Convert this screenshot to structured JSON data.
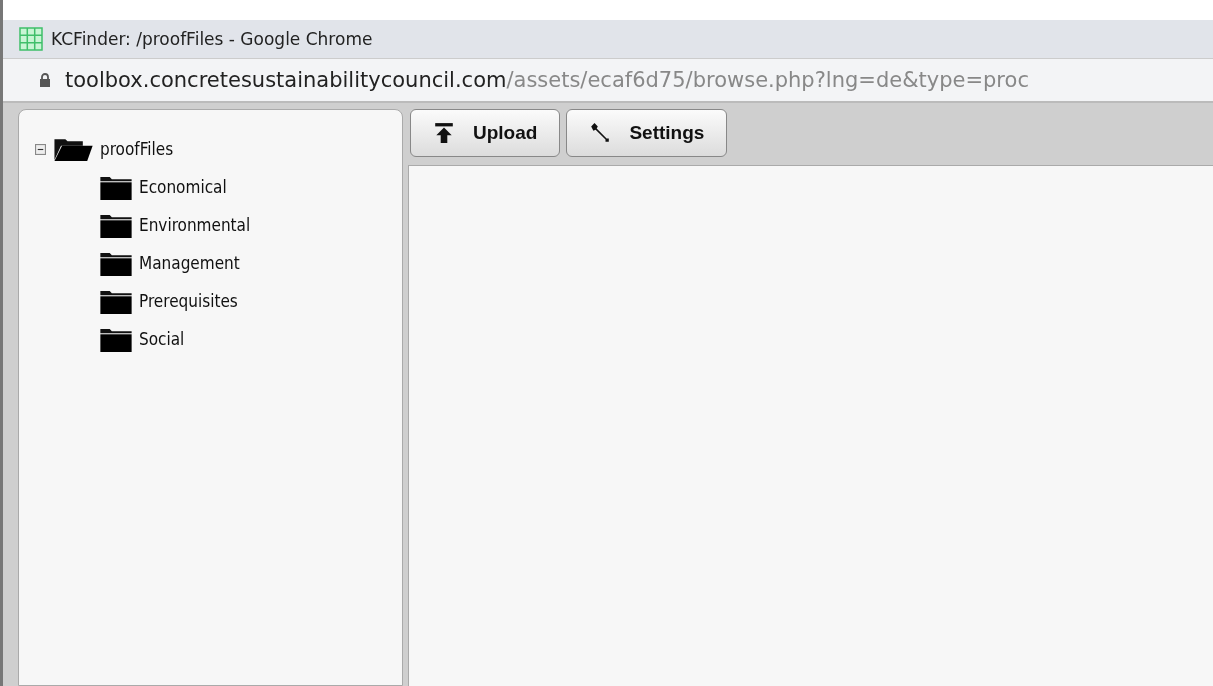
{
  "window": {
    "title": "KCFinder: /proofFiles - Google Chrome"
  },
  "address_bar": {
    "host": "toolbox.concretesustainabilitycouncil.com",
    "path": "/assets/ecaf6d75/browse.php?lng=de&type=proc"
  },
  "tree": [
    {
      "label": "proofFiles",
      "expanded": true,
      "children": [
        {
          "label": "Economical"
        },
        {
          "label": "Environmental"
        },
        {
          "label": "Management"
        },
        {
          "label": "Prerequisites"
        },
        {
          "label": "Social"
        }
      ]
    }
  ],
  "toolbar": [
    {
      "label": "Upload",
      "kind": "upload"
    },
    {
      "label": "Settings",
      "kind": "settings"
    }
  ]
}
